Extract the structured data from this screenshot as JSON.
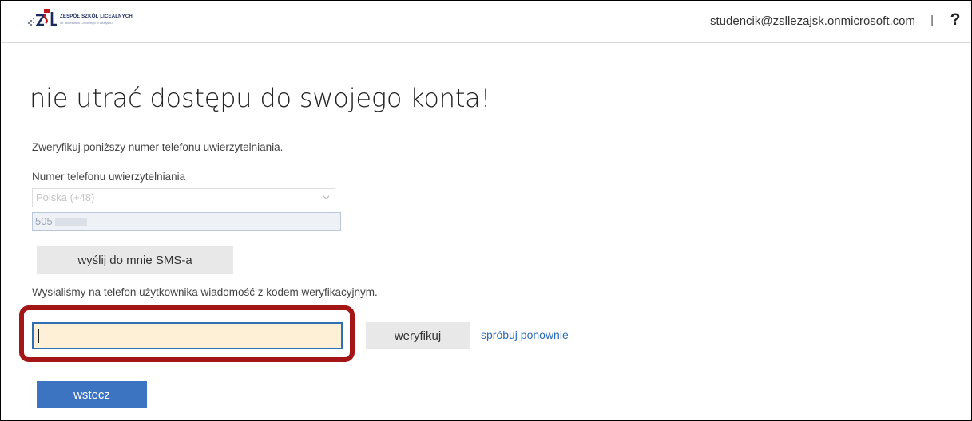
{
  "header": {
    "logo_title": "ZESPÓŁ SZKÓŁ LICEALNYCH",
    "logo_subtitle": "im. Bolesława Chrobrego w Lezajsku",
    "logo_colors": {
      "red": "#c4161c",
      "blue": "#1a2a5e"
    },
    "user_email": "studencik@zsllezajsk.onmicrosoft.com",
    "separator": "|",
    "help_label": "?"
  },
  "main": {
    "title": "nie utrać dostępu do swojego konta!",
    "instruction": "Zweryfikuj poniższy numer telefonu uwierzytelniania.",
    "phone_label": "Numer telefonu uwierzytelniania",
    "country_select": {
      "selected": "Polska (+48)",
      "icon": "chevron-down-icon"
    },
    "phone_input": {
      "value_prefix": "505",
      "value_obscured": true
    },
    "sms_button": "wyślij do mnie SMS-a",
    "sent_message": "Wysłaliśmy na telefon użytkownika wiadomość z kodem weryfikacyjnym.",
    "code_input": {
      "value": "",
      "placeholder": ""
    },
    "verify_button": "weryfikuj",
    "retry_link": "spróbuj ponownie",
    "back_button": "wstecz"
  },
  "colors": {
    "accent": "#3d74c2",
    "link": "#2b6cb8",
    "highlight_border": "#a41515",
    "code_input_bg": "#fdf0d6",
    "button_gray": "#e8e8e8"
  }
}
